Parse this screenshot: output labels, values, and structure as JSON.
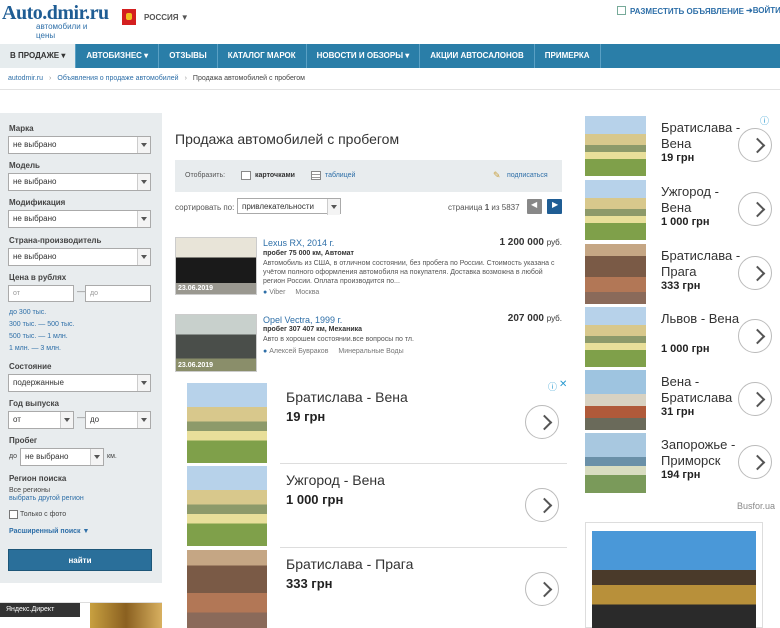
{
  "header": {
    "logo_title": "Auto.dmir.ru",
    "logo_subtitle": "автомобили и цены",
    "country": "РОССИЯ ▼",
    "post_ad": "РАЗМЕСТИТЬ ОБЪЯВЛЕНИЕ",
    "login": "ВОЙТИ"
  },
  "nav": [
    "В ПРОДАЖЕ ▾",
    "АВТОБИЗНЕС ▾",
    "ОТЗЫВЫ",
    "КАТАЛОГ МАРОК",
    "НОВОСТИ И ОБЗОРЫ ▾",
    "АКЦИИ АВТОСАЛОНОВ",
    "ПРИМЕРКА"
  ],
  "breadcrumbs": [
    "autodmir.ru",
    "Объявления о продаже автомобилей",
    "Продажа автомобилей с пробегом"
  ],
  "sidebar": {
    "brand_label": "Марка",
    "brand_value": "не выбрано",
    "model_label": "Модель",
    "model_value": "не выбрано",
    "mod_label": "Модификация",
    "mod_value": "не выбрано",
    "country_label": "Страна-производитель",
    "country_value": "не выбрано",
    "price_label": "Цена в рублях",
    "price_from": "от",
    "price_to": "до",
    "price_links": [
      "до 300 тыс.",
      "300 тыс. — 500 тыс.",
      "500 тыс. — 1 млн.",
      "1 млн. — 3 млн."
    ],
    "state_label": "Состояние",
    "state_value": "подержанные",
    "year_label": "Год выпуска",
    "year_from": "от",
    "year_to": "до",
    "mileage_label": "Пробег",
    "mileage_prefix": "до",
    "mileage_value": "не выбрано",
    "mileage_unit": "км.",
    "region_label": "Регион поиска",
    "region_value": "Все регионы",
    "region_link": "выбрать другой регион",
    "photo_only": "Только с фото",
    "advanced": "Расширенный поиск ▼",
    "find_button": "найти",
    "yandex": "Яндекс.Директ"
  },
  "main": {
    "title": "Продажа автомобилей с пробегом",
    "view_label": "Отобразить:",
    "view_cards": "карточками",
    "view_table": "таблицей",
    "subscribe": "подписаться",
    "sort_label": "сортировать по:",
    "sort_value": "привлекательности",
    "page_text": "страница",
    "page_current": "1",
    "page_of": "из 5837"
  },
  "listings": [
    {
      "title": "Lexus RX, 2014 г.",
      "price": "1 200 000",
      "currency": "руб.",
      "sub": "пробег 75 000 км, Автомат",
      "desc": "Автомобиль из США, в отличном состоянии, без пробега по России. Стоимость указана с учётом полного оформления автомобиля на покупателя. Доставка возможна в любой регион России. Оплата производится по...",
      "seller": "Viber",
      "city": "Москва",
      "date": "23.06.2019"
    },
    {
      "title": "Opel Vectra, 1999 г.",
      "price": "207 000",
      "currency": "руб.",
      "sub": "пробег 307 407 км, Механика",
      "desc": "Авто в хорошем состоянии.все вопросы по тл.",
      "seller": "Алексей Бувраков",
      "city": "Минеральные Воды",
      "date": "23.06.2019"
    }
  ],
  "inline_ads": [
    {
      "route": "Братислава - Вена",
      "price": "19 грн"
    },
    {
      "route": "Ужгород - Вена",
      "price": "1 000 грн"
    },
    {
      "route": "Братислава - Прага",
      "price": "333 грн"
    }
  ],
  "right_ads": [
    {
      "route": "Братислава - Вена",
      "price": "19 грн"
    },
    {
      "route": "Ужгород - Вена",
      "price": "1 000 грн"
    },
    {
      "route": "Братислава - Прага",
      "price": "333 грн"
    },
    {
      "route": "Львов - Вена",
      "price": "1 000 грн"
    },
    {
      "route": "Вена - Братислава",
      "price": "31 грн"
    },
    {
      "route": "Запорожье - Приморск",
      "price": "194 грн"
    }
  ],
  "right_ads_source": "Busfor.ua"
}
